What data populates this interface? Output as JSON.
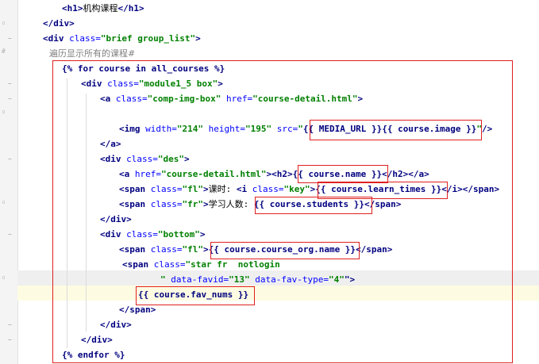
{
  "lines": [
    {
      "n": 1,
      "indent": 78,
      "tokens": [
        [
          "tag",
          "<h1>"
        ],
        [
          "txt",
          "机构课程"
        ],
        [
          "tag",
          "</h1>"
        ]
      ]
    },
    {
      "n": 2,
      "indent": 54,
      "tokens": [
        [
          "tag",
          "</div>"
        ]
      ]
    },
    {
      "n": 3,
      "indent": 54,
      "tokens": [
        [
          "tag",
          "<div "
        ],
        [
          "attr",
          "class="
        ],
        [
          "val",
          "\"brief group_list\""
        ],
        [
          "tag",
          ">"
        ]
      ]
    },
    {
      "n": 4,
      "indent": 62,
      "tokens": [
        [
          "cmt",
          "遍历显示所有的课程#"
        ]
      ]
    },
    {
      "n": 5,
      "indent": 78,
      "tokens": [
        [
          "tpl",
          "{% for course in all_courses %}"
        ]
      ]
    },
    {
      "n": 6,
      "indent": 102,
      "tokens": [
        [
          "tag",
          "<div "
        ],
        [
          "attr",
          "class="
        ],
        [
          "val",
          "\"module1_5 box\""
        ],
        [
          "tag",
          ">"
        ]
      ]
    },
    {
      "n": 7,
      "indent": 126,
      "tokens": [
        [
          "tag",
          "<a "
        ],
        [
          "attr",
          "class="
        ],
        [
          "val",
          "\"comp-img-box\" "
        ],
        [
          "attr",
          "href="
        ],
        [
          "val",
          "\"course-detail.html\""
        ],
        [
          "tag",
          ">"
        ]
      ]
    },
    {
      "n": 8,
      "indent": 126,
      "tokens": []
    },
    {
      "n": 9,
      "indent": 150,
      "tokens": [
        [
          "tag",
          "<img "
        ],
        [
          "attr",
          "width="
        ],
        [
          "val",
          "\"214\" "
        ],
        [
          "attr",
          "height="
        ],
        [
          "val",
          "\"195\" "
        ],
        [
          "attr",
          "src="
        ],
        [
          "val",
          "\""
        ],
        [
          "tpl",
          "{{ MEDIA_URL }}{{ course.image }}"
        ],
        [
          "val",
          "\""
        ],
        [
          "tag",
          "/>"
        ]
      ]
    },
    {
      "n": 10,
      "indent": 126,
      "tokens": [
        [
          "tag",
          "</a>"
        ]
      ]
    },
    {
      "n": 11,
      "indent": 126,
      "tokens": [
        [
          "tag",
          "<div "
        ],
        [
          "attr",
          "class="
        ],
        [
          "val",
          "\"des\""
        ],
        [
          "tag",
          ">"
        ]
      ]
    },
    {
      "n": 12,
      "indent": 150,
      "tokens": [
        [
          "tag",
          "<a "
        ],
        [
          "attr",
          "href="
        ],
        [
          "val",
          "\"course-detail.html\""
        ],
        [
          "tag",
          ">"
        ],
        [
          "tag",
          "<h2>"
        ],
        [
          "tpl",
          "{{ course.name }}"
        ],
        [
          "tag",
          "</h2>"
        ],
        [
          "tag",
          "</a>"
        ]
      ]
    },
    {
      "n": 13,
      "indent": 150,
      "tokens": [
        [
          "tag",
          "<span "
        ],
        [
          "attr",
          "class="
        ],
        [
          "val",
          "\"fl\""
        ],
        [
          "tag",
          ">"
        ],
        [
          "txt",
          "课时: "
        ],
        [
          "tag",
          "<i "
        ],
        [
          "attr",
          "class="
        ],
        [
          "val",
          "\"key\""
        ],
        [
          "tag",
          ">"
        ],
        [
          "tpl",
          "{{ course.learn_times }}"
        ],
        [
          "tag",
          "</i>"
        ],
        [
          "tag",
          "</span>"
        ]
      ]
    },
    {
      "n": 14,
      "indent": 150,
      "tokens": [
        [
          "tag",
          "<span "
        ],
        [
          "attr",
          "class="
        ],
        [
          "val",
          "\"fr\""
        ],
        [
          "tag",
          ">"
        ],
        [
          "txt",
          "学习人数: "
        ],
        [
          "tpl",
          "{{ course.students }}"
        ],
        [
          "tag",
          "</span>"
        ]
      ]
    },
    {
      "n": 15,
      "indent": 126,
      "tokens": [
        [
          "tag",
          "</div>"
        ]
      ]
    },
    {
      "n": 16,
      "indent": 126,
      "tokens": [
        [
          "tag",
          "<div "
        ],
        [
          "attr",
          "class="
        ],
        [
          "val",
          "\"bottom\""
        ],
        [
          "tag",
          ">"
        ]
      ]
    },
    {
      "n": 17,
      "indent": 150,
      "tokens": [
        [
          "tag",
          "<span "
        ],
        [
          "attr",
          "class="
        ],
        [
          "val",
          "\"fl\""
        ],
        [
          "tag",
          ">"
        ],
        [
          "tpl",
          "{{ course.course_org.name }}"
        ],
        [
          "tag",
          "</span>"
        ]
      ]
    },
    {
      "n": 18,
      "indent": 154,
      "tokens": [
        [
          "tag",
          "<span "
        ],
        [
          "attr",
          "class="
        ],
        [
          "val",
          "\"star fr  notlogin"
        ]
      ]
    },
    {
      "n": 19,
      "indent": 202,
      "tokens": [
        [
          "val",
          "\" "
        ],
        [
          "attr",
          "data-favid="
        ],
        [
          "val",
          "\"13\" "
        ],
        [
          "attr",
          "data-fav-type="
        ],
        [
          "val",
          "\"4\""
        ],
        [
          "tag",
          "\">"
        ]
      ]
    },
    {
      "n": 20,
      "indent": 174,
      "tokens": [
        [
          "tpl",
          "{{ course.fav_nums }}"
        ]
      ]
    },
    {
      "n": 21,
      "indent": 150,
      "tokens": [
        [
          "tag",
          "</span>"
        ]
      ]
    },
    {
      "n": 22,
      "indent": 126,
      "tokens": [
        [
          "tag",
          "</div>"
        ]
      ]
    },
    {
      "n": 23,
      "indent": 102,
      "tokens": [
        [
          "tag",
          "</div>"
        ]
      ]
    },
    {
      "n": 24,
      "indent": 78,
      "tokens": [
        [
          "tpl",
          "{% endfor %}"
        ]
      ]
    }
  ]
}
